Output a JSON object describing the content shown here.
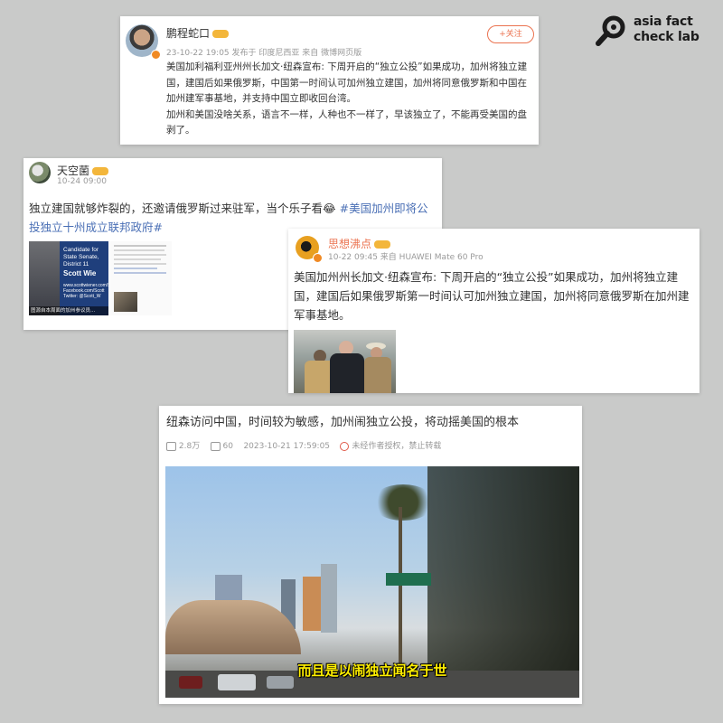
{
  "logo": {
    "line1": "asia fact",
    "line2": "check lab"
  },
  "post1": {
    "username": "鹏程蛇口",
    "meta": "23-10-22 19:05 发布于 印度尼西亚 来自 微博网页版",
    "follow": "+关注",
    "p1": "美国加利福利亚州州长加文·纽森宣布: 下周开启的“独立公投”如果成功，加州将独立建国，建国后如果俄罗斯，中国第一时间认可加州独立建国，加州将同意俄罗斯和中国在加州建军事基地，并支持中国立即收回台湾。",
    "p2": "加州和美国没啥关系，语言不一样，人种也不一样了，早该独立了，不能再受美国的盘剥了。"
  },
  "post2": {
    "username": "天空菌",
    "meta": "10-24 09:00",
    "text": "独立建国就够炸裂的，还邀请俄罗斯过来驻军，当个乐子看",
    "emoji": "😂",
    "hashtag": "#美国加州即将公投独立十州成立联邦政府#",
    "img_lines": [
      "Candidate for",
      "State Senate,",
      "District 11",
      "Scott Wie"
    ],
    "img_site": "www.scottwiener.com/Sco",
    "img_fb": "Facebook.com/Scott",
    "img_tw": "Twitter: @Scott_W",
    "img_caption": "图源自本周面的加州参议员..."
  },
  "post3": {
    "username": "思想沸点",
    "meta": "10-22 09:45 来自 HUAWEI Mate 60 Pro",
    "text": "美国加州州长加文·纽森宣布: 下周开启的“独立公投”如果成功，加州将独立建国，建国后如果俄罗斯第一时间认可加州独立建国，加州将同意俄罗斯在加州建军事基地。"
  },
  "post4": {
    "title": "纽森访问中国，时间较为敏感，加州闹独立公投，将动摇美国的根本",
    "views": "2.8万",
    "comments": "60",
    "datetime": "2023-10-21 17:59:05",
    "copyright": "未经作者授权，禁止转载",
    "subtitle": "而且是以闹独立闻名于世"
  },
  "colors": {
    "background": "#c9cac9",
    "weibo_orange": "#eb7350",
    "hashtag_blue": "#4a6fb5",
    "subtitle_yellow": "#ffef00"
  }
}
